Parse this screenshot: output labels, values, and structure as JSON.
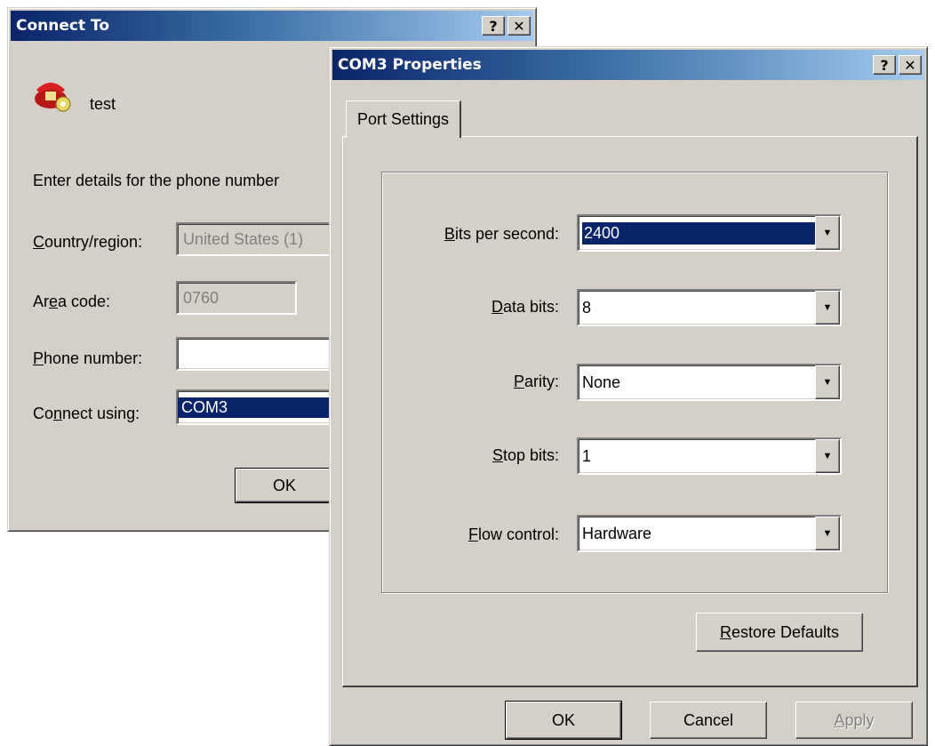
{
  "connect_to": {
    "title": "Connect To",
    "help_btn": "?",
    "close_btn": "✕",
    "connection_name": "test",
    "instruction": "Enter details for the phone number",
    "country_label_u": "C",
    "country_label_rest": "ountry/region:",
    "country_value": "United States (1)",
    "area_label_pre": "Ar",
    "area_label_u": "e",
    "area_label_rest": "a code:",
    "area_value": "0760",
    "phone_label_u": "P",
    "phone_label_rest": "hone number:",
    "phone_value": "",
    "connect_label_pre": "Co",
    "connect_label_u": "n",
    "connect_label_rest": "nect using:",
    "connect_value": "COM3",
    "ok_label": "OK"
  },
  "com3": {
    "title": "COM3 Properties",
    "help_btn": "?",
    "close_btn": "✕",
    "tab_label": "Port Settings",
    "fields": [
      {
        "label_u": "B",
        "label_rest": "its per second:",
        "value": "2400"
      },
      {
        "label_u": "D",
        "label_rest": "ata bits:",
        "value": "8"
      },
      {
        "label_u": "P",
        "label_rest": "arity:",
        "value": "None"
      },
      {
        "label_u": "S",
        "label_rest": "top bits:",
        "value": "1"
      },
      {
        "label_u": "F",
        "label_rest": "low control:",
        "value": "Hardware"
      }
    ],
    "restore_u": "R",
    "restore_rest": "estore Defaults",
    "ok_label": "OK",
    "cancel_label": "Cancel",
    "apply_u": "A",
    "apply_rest": "pply",
    "dropdown_arrow": "▼"
  }
}
